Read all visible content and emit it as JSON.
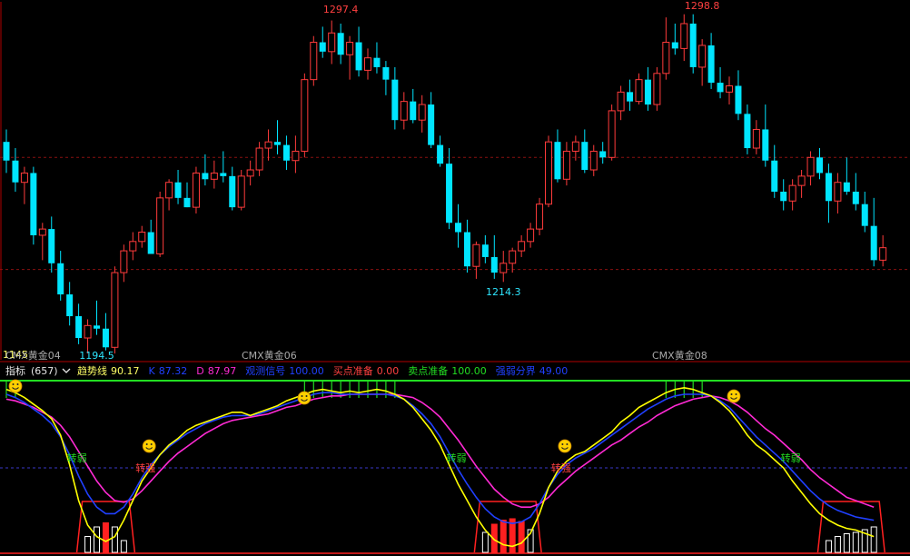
{
  "colors": {
    "up": "#ff3b3b",
    "down": "#00e5ff",
    "trend": "#ffff00",
    "k": "#2040ff",
    "d": "#ff2ad4",
    "observe": "#22dd22",
    "buyBox": "#ff2020",
    "frame": "#b00000",
    "grid": "#8a1010",
    "contract": "#a8a8a8",
    "cyanText": "#2ee6ff",
    "redText": "#ff4040",
    "textWhite": "#e6e6e6",
    "textYellow": "#ffff66",
    "textGreen": "#22dd22"
  },
  "price_panel": {
    "high_labels": [
      "1297.4",
      "1298.8"
    ],
    "low_labels": [
      "1194.5",
      "1214.3"
    ],
    "corner_label": "1145",
    "contract_labels": [
      "CMX黄金04",
      "CMX黄金06",
      "CMX黄金08"
    ]
  },
  "indicator_header": {
    "title": "指标",
    "period": "(657)",
    "dropdown_icon": "chevron-down-icon",
    "items": [
      {
        "name": "趋势线",
        "value": "90.17",
        "color": "#ffff66"
      },
      {
        "name": "K",
        "value": "87.32",
        "color": "#2040ff"
      },
      {
        "name": "D",
        "value": "87.97",
        "color": "#ff2ad4"
      },
      {
        "name": "观测信号",
        "value": "100.00",
        "color": "#2040ff"
      },
      {
        "name": "买点准备",
        "value": "0.00",
        "color": "#ff4040"
      },
      {
        "name": "卖点准备",
        "value": "100.00",
        "color": "#22dd22"
      },
      {
        "name": "强弱分界",
        "value": "49.00",
        "color": "#2040ff"
      }
    ]
  },
  "annotations": {
    "weak": "转弱",
    "strong": "转强",
    "smiley_icon": "smiley-icon"
  },
  "chart_data": [
    {
      "type": "candlestick",
      "title": "",
      "ylim": [
        1188,
        1303
      ],
      "reference_lines": [
        1253,
        1217
      ],
      "ohlc": [
        [
          1258,
          1262,
          1248,
          1252
        ],
        [
          1252,
          1256,
          1242,
          1245
        ],
        [
          1245,
          1250,
          1238,
          1248
        ],
        [
          1248,
          1250,
          1225,
          1228
        ],
        [
          1228,
          1232,
          1220,
          1230
        ],
        [
          1230,
          1234,
          1216,
          1219
        ],
        [
          1219,
          1223,
          1207,
          1209
        ],
        [
          1209,
          1213,
          1199,
          1202
        ],
        [
          1202,
          1206,
          1193,
          1195
        ],
        [
          1195,
          1201,
          1190,
          1199
        ],
        [
          1199,
          1207,
          1196,
          1198
        ],
        [
          1198,
          1203,
          1191,
          1192
        ],
        [
          1192,
          1218,
          1190,
          1216
        ],
        [
          1216,
          1225,
          1213,
          1223
        ],
        [
          1223,
          1229,
          1220,
          1226
        ],
        [
          1226,
          1231,
          1224,
          1229
        ],
        [
          1229,
          1233,
          1226,
          1222
        ],
        [
          1222,
          1242,
          1221,
          1240
        ],
        [
          1240,
          1246,
          1236,
          1245
        ],
        [
          1245,
          1249,
          1238,
          1240
        ],
        [
          1240,
          1245,
          1237,
          1237
        ],
        [
          1237,
          1250,
          1235,
          1248
        ],
        [
          1248,
          1254,
          1244,
          1246
        ],
        [
          1246,
          1252,
          1243,
          1248
        ],
        [
          1248,
          1255,
          1245,
          1247
        ],
        [
          1247,
          1250,
          1236,
          1237
        ],
        [
          1237,
          1249,
          1236,
          1247
        ],
        [
          1247,
          1252,
          1244,
          1249
        ],
        [
          1249,
          1258,
          1247,
          1256
        ],
        [
          1256,
          1262,
          1252,
          1258
        ],
        [
          1258,
          1265,
          1254,
          1257
        ],
        [
          1257,
          1260,
          1249,
          1252
        ],
        [
          1252,
          1260,
          1248,
          1255
        ],
        [
          1255,
          1280,
          1253,
          1278
        ],
        [
          1278,
          1292,
          1276,
          1290
        ],
        [
          1290,
          1295,
          1285,
          1287
        ],
        [
          1287,
          1297,
          1283,
          1293
        ],
        [
          1293,
          1296,
          1283,
          1286
        ],
        [
          1286,
          1292,
          1278,
          1290
        ],
        [
          1290,
          1295,
          1279,
          1281
        ],
        [
          1281,
          1288,
          1278,
          1285
        ],
        [
          1285,
          1290,
          1280,
          1282
        ],
        [
          1282,
          1284,
          1273,
          1278
        ],
        [
          1278,
          1282,
          1262,
          1265
        ],
        [
          1265,
          1274,
          1262,
          1271
        ],
        [
          1271,
          1275,
          1264,
          1265
        ],
        [
          1265,
          1273,
          1261,
          1270
        ],
        [
          1270,
          1274,
          1256,
          1257
        ],
        [
          1257,
          1260,
          1250,
          1251
        ],
        [
          1251,
          1256,
          1230,
          1232
        ],
        [
          1232,
          1238,
          1224,
          1229
        ],
        [
          1229,
          1233,
          1216,
          1218
        ],
        [
          1218,
          1226,
          1214,
          1225
        ],
        [
          1225,
          1228,
          1219,
          1221
        ],
        [
          1221,
          1228,
          1214,
          1216
        ],
        [
          1216,
          1223,
          1213,
          1219
        ],
        [
          1219,
          1224,
          1216,
          1223
        ],
        [
          1223,
          1228,
          1221,
          1226
        ],
        [
          1226,
          1232,
          1224,
          1230
        ],
        [
          1230,
          1240,
          1228,
          1238
        ],
        [
          1238,
          1260,
          1237,
          1258
        ],
        [
          1258,
          1262,
          1245,
          1246
        ],
        [
          1246,
          1258,
          1244,
          1255
        ],
        [
          1255,
          1260,
          1252,
          1258
        ],
        [
          1258,
          1262,
          1248,
          1249
        ],
        [
          1249,
          1257,
          1247,
          1255
        ],
        [
          1255,
          1258,
          1251,
          1253
        ],
        [
          1253,
          1270,
          1252,
          1268
        ],
        [
          1268,
          1276,
          1265,
          1274
        ],
        [
          1274,
          1278,
          1268,
          1271
        ],
        [
          1271,
          1280,
          1270,
          1278
        ],
        [
          1278,
          1282,
          1268,
          1270
        ],
        [
          1270,
          1282,
          1268,
          1280
        ],
        [
          1280,
          1298,
          1278,
          1290
        ],
        [
          1290,
          1296,
          1286,
          1288
        ],
        [
          1288,
          1299,
          1284,
          1296
        ],
        [
          1296,
          1299,
          1280,
          1282
        ],
        [
          1282,
          1291,
          1276,
          1289
        ],
        [
          1289,
          1293,
          1275,
          1277
        ],
        [
          1277,
          1282,
          1272,
          1274
        ],
        [
          1274,
          1279,
          1270,
          1276
        ],
        [
          1276,
          1281,
          1265,
          1267
        ],
        [
          1267,
          1270,
          1254,
          1256
        ],
        [
          1256,
          1265,
          1254,
          1262
        ],
        [
          1262,
          1270,
          1250,
          1252
        ],
        [
          1252,
          1257,
          1240,
          1242
        ],
        [
          1242,
          1246,
          1236,
          1239
        ],
        [
          1239,
          1246,
          1236,
          1244
        ],
        [
          1244,
          1249,
          1240,
          1247
        ],
        [
          1247,
          1255,
          1244,
          1253
        ],
        [
          1253,
          1256,
          1246,
          1248
        ],
        [
          1248,
          1251,
          1232,
          1239
        ],
        [
          1239,
          1248,
          1235,
          1245
        ],
        [
          1245,
          1253,
          1241,
          1242
        ],
        [
          1242,
          1248,
          1236,
          1238
        ],
        [
          1238,
          1242,
          1229,
          1231
        ],
        [
          1231,
          1240,
          1218,
          1220
        ],
        [
          1220,
          1228,
          1218,
          1224
        ]
      ]
    },
    {
      "type": "line",
      "title": "",
      "ylim": [
        0,
        100
      ],
      "series": [
        {
          "name": "趋势线",
          "values": [
            98,
            96,
            93,
            89,
            85,
            80,
            70,
            52,
            30,
            15,
            8,
            5,
            8,
            18,
            30,
            42,
            50,
            58,
            64,
            68,
            73,
            76,
            78,
            80,
            82,
            84,
            84,
            82,
            84,
            86,
            88,
            91,
            93,
            95,
            97,
            98,
            97,
            96,
            97,
            96,
            97,
            98,
            97,
            95,
            92,
            87,
            80,
            73,
            64,
            52,
            40,
            30,
            20,
            12,
            6,
            3,
            2,
            4,
            10,
            22,
            38,
            48,
            54,
            58,
            60,
            64,
            68,
            72,
            78,
            82,
            87,
            90,
            93,
            96,
            98,
            99,
            98,
            96,
            94,
            90,
            85,
            78,
            70,
            64,
            60,
            55,
            50,
            42,
            35,
            28,
            22,
            18,
            15,
            13,
            12,
            10,
            8
          ]
        },
        {
          "name": "K",
          "values": [
            95,
            93,
            90,
            86,
            82,
            77,
            69,
            58,
            45,
            34,
            26,
            22,
            22,
            26,
            34,
            44,
            52,
            58,
            63,
            67,
            71,
            74,
            77,
            79,
            81,
            82,
            82,
            82,
            83,
            85,
            87,
            89,
            91,
            93,
            95,
            96,
            96,
            95,
            95,
            95,
            95,
            95,
            95,
            94,
            92,
            88,
            83,
            77,
            69,
            59,
            49,
            40,
            32,
            25,
            20,
            17,
            16,
            17,
            20,
            28,
            38,
            46,
            52,
            56,
            59,
            62,
            66,
            70,
            74,
            78,
            82,
            86,
            89,
            92,
            94,
            95,
            95,
            95,
            94,
            91,
            87,
            81,
            75,
            69,
            64,
            59,
            54,
            48,
            42,
            36,
            31,
            27,
            24,
            22,
            20,
            19,
            18
          ]
        },
        {
          "name": "D",
          "values": [
            92,
            91,
            89,
            87,
            84,
            81,
            76,
            69,
            60,
            51,
            42,
            35,
            30,
            29,
            31,
            36,
            42,
            48,
            54,
            59,
            63,
            67,
            71,
            74,
            77,
            79,
            80,
            81,
            82,
            83,
            85,
            87,
            88,
            90,
            92,
            93,
            94,
            94,
            95,
            95,
            95,
            95,
            95,
            95,
            94,
            93,
            90,
            86,
            81,
            74,
            67,
            59,
            51,
            44,
            37,
            32,
            28,
            26,
            26,
            28,
            32,
            38,
            43,
            48,
            52,
            56,
            60,
            64,
            67,
            71,
            75,
            78,
            82,
            85,
            88,
            90,
            92,
            93,
            94,
            93,
            91,
            88,
            84,
            79,
            74,
            70,
            65,
            60,
            55,
            49,
            44,
            40,
            36,
            32,
            30,
            28,
            26
          ]
        }
      ]
    }
  ]
}
